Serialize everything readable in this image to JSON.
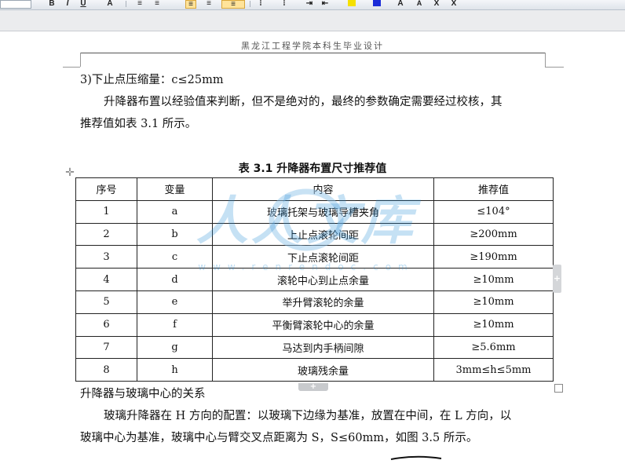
{
  "header": {
    "text": "黑龙江工程学院本科生毕业设计"
  },
  "paragraphs": {
    "item3": "3)下止点压缩量：c≤25mm",
    "p1_line1": "升降器布置以经验值来判断，但不是绝对的，最终的参数确定需要经过校核，其",
    "p1_line2": "推荐值如表 3.1 所示。",
    "subheading": "升降器与玻璃中心的关系",
    "p2_line1": "玻璃升降器在 H 方向的配置：以玻璃下边缘为基准，放置在中间，在 L 方向，以",
    "p2_line2": "玻璃中心为基准，玻璃中心与臂交叉点距离为 S，S≤60mm，如图 3.5 所示。"
  },
  "table": {
    "caption": "表 3.1  升降器布置尺寸推荐值",
    "headers": [
      "序号",
      "变量",
      "内容",
      "推荐值"
    ],
    "rows": [
      [
        "1",
        "a",
        "玻璃托架与玻璃导槽夹角",
        "≤104°"
      ],
      [
        "2",
        "b",
        "上止点滚轮间距",
        "≥200mm"
      ],
      [
        "3",
        "c",
        "下止点滚轮间距",
        "≥190mm"
      ],
      [
        "4",
        "d",
        "滚轮中心到止点余量",
        "≥10mm"
      ],
      [
        "5",
        "e",
        "举升臂滚轮的余量",
        "≥10mm"
      ],
      [
        "6",
        "f",
        "平衡臂滚轮中心的余量",
        "≥10mm"
      ],
      [
        "7",
        "g",
        "马达到内手柄间隙",
        "≥5.6mm"
      ],
      [
        "8",
        "h",
        "玻璃残余量",
        "3mm≤h≤5mm"
      ]
    ]
  },
  "watermark": {
    "text": "人人文库",
    "url_text": "www.renrendoc.com"
  },
  "toolbar": {
    "buttons": [
      "B",
      "I",
      "U",
      "A",
      "A",
      "A",
      "X",
      "X"
    ],
    "colors": {
      "highlight": "#f5e000",
      "font_color": "#1a2bd8",
      "accent": "#2a8fd6"
    }
  }
}
